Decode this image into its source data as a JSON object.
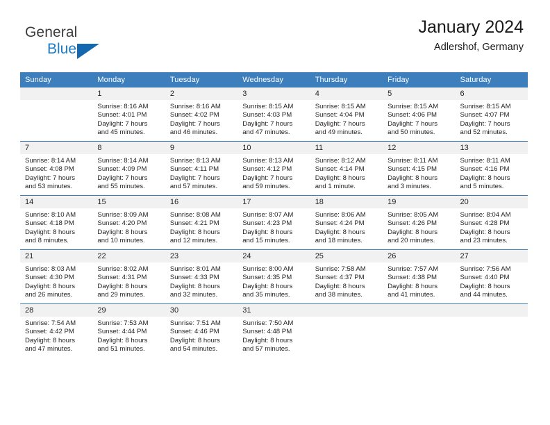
{
  "brand": {
    "line1": "General",
    "line2": "Blue",
    "triangle_color": "#1368b0",
    "blue_text_color": "#1d7ac4"
  },
  "header": {
    "title": "January 2024",
    "subtitle": "Adlershof, Germany"
  },
  "theme": {
    "header_blue": "#3d7ebc",
    "daynum_gray": "#f1f1f1",
    "text": "#231f20"
  },
  "calendar": {
    "weekday_headers": [
      "Sunday",
      "Monday",
      "Tuesday",
      "Wednesday",
      "Thursday",
      "Friday",
      "Saturday"
    ],
    "weeks": [
      [
        {
          "day": "",
          "lines": []
        },
        {
          "day": "1",
          "lines": [
            "Sunrise: 8:16 AM",
            "Sunset: 4:01 PM",
            "Daylight: 7 hours",
            "and 45 minutes."
          ]
        },
        {
          "day": "2",
          "lines": [
            "Sunrise: 8:16 AM",
            "Sunset: 4:02 PM",
            "Daylight: 7 hours",
            "and 46 minutes."
          ]
        },
        {
          "day": "3",
          "lines": [
            "Sunrise: 8:15 AM",
            "Sunset: 4:03 PM",
            "Daylight: 7 hours",
            "and 47 minutes."
          ]
        },
        {
          "day": "4",
          "lines": [
            "Sunrise: 8:15 AM",
            "Sunset: 4:04 PM",
            "Daylight: 7 hours",
            "and 49 minutes."
          ]
        },
        {
          "day": "5",
          "lines": [
            "Sunrise: 8:15 AM",
            "Sunset: 4:06 PM",
            "Daylight: 7 hours",
            "and 50 minutes."
          ]
        },
        {
          "day": "6",
          "lines": [
            "Sunrise: 8:15 AM",
            "Sunset: 4:07 PM",
            "Daylight: 7 hours",
            "and 52 minutes."
          ]
        }
      ],
      [
        {
          "day": "7",
          "lines": [
            "Sunrise: 8:14 AM",
            "Sunset: 4:08 PM",
            "Daylight: 7 hours",
            "and 53 minutes."
          ]
        },
        {
          "day": "8",
          "lines": [
            "Sunrise: 8:14 AM",
            "Sunset: 4:09 PM",
            "Daylight: 7 hours",
            "and 55 minutes."
          ]
        },
        {
          "day": "9",
          "lines": [
            "Sunrise: 8:13 AM",
            "Sunset: 4:11 PM",
            "Daylight: 7 hours",
            "and 57 minutes."
          ]
        },
        {
          "day": "10",
          "lines": [
            "Sunrise: 8:13 AM",
            "Sunset: 4:12 PM",
            "Daylight: 7 hours",
            "and 59 minutes."
          ]
        },
        {
          "day": "11",
          "lines": [
            "Sunrise: 8:12 AM",
            "Sunset: 4:14 PM",
            "Daylight: 8 hours",
            "and 1 minute."
          ]
        },
        {
          "day": "12",
          "lines": [
            "Sunrise: 8:11 AM",
            "Sunset: 4:15 PM",
            "Daylight: 8 hours",
            "and 3 minutes."
          ]
        },
        {
          "day": "13",
          "lines": [
            "Sunrise: 8:11 AM",
            "Sunset: 4:16 PM",
            "Daylight: 8 hours",
            "and 5 minutes."
          ]
        }
      ],
      [
        {
          "day": "14",
          "lines": [
            "Sunrise: 8:10 AM",
            "Sunset: 4:18 PM",
            "Daylight: 8 hours",
            "and 8 minutes."
          ]
        },
        {
          "day": "15",
          "lines": [
            "Sunrise: 8:09 AM",
            "Sunset: 4:20 PM",
            "Daylight: 8 hours",
            "and 10 minutes."
          ]
        },
        {
          "day": "16",
          "lines": [
            "Sunrise: 8:08 AM",
            "Sunset: 4:21 PM",
            "Daylight: 8 hours",
            "and 12 minutes."
          ]
        },
        {
          "day": "17",
          "lines": [
            "Sunrise: 8:07 AM",
            "Sunset: 4:23 PM",
            "Daylight: 8 hours",
            "and 15 minutes."
          ]
        },
        {
          "day": "18",
          "lines": [
            "Sunrise: 8:06 AM",
            "Sunset: 4:24 PM",
            "Daylight: 8 hours",
            "and 18 minutes."
          ]
        },
        {
          "day": "19",
          "lines": [
            "Sunrise: 8:05 AM",
            "Sunset: 4:26 PM",
            "Daylight: 8 hours",
            "and 20 minutes."
          ]
        },
        {
          "day": "20",
          "lines": [
            "Sunrise: 8:04 AM",
            "Sunset: 4:28 PM",
            "Daylight: 8 hours",
            "and 23 minutes."
          ]
        }
      ],
      [
        {
          "day": "21",
          "lines": [
            "Sunrise: 8:03 AM",
            "Sunset: 4:30 PM",
            "Daylight: 8 hours",
            "and 26 minutes."
          ]
        },
        {
          "day": "22",
          "lines": [
            "Sunrise: 8:02 AM",
            "Sunset: 4:31 PM",
            "Daylight: 8 hours",
            "and 29 minutes."
          ]
        },
        {
          "day": "23",
          "lines": [
            "Sunrise: 8:01 AM",
            "Sunset: 4:33 PM",
            "Daylight: 8 hours",
            "and 32 minutes."
          ]
        },
        {
          "day": "24",
          "lines": [
            "Sunrise: 8:00 AM",
            "Sunset: 4:35 PM",
            "Daylight: 8 hours",
            "and 35 minutes."
          ]
        },
        {
          "day": "25",
          "lines": [
            "Sunrise: 7:58 AM",
            "Sunset: 4:37 PM",
            "Daylight: 8 hours",
            "and 38 minutes."
          ]
        },
        {
          "day": "26",
          "lines": [
            "Sunrise: 7:57 AM",
            "Sunset: 4:38 PM",
            "Daylight: 8 hours",
            "and 41 minutes."
          ]
        },
        {
          "day": "27",
          "lines": [
            "Sunrise: 7:56 AM",
            "Sunset: 4:40 PM",
            "Daylight: 8 hours",
            "and 44 minutes."
          ]
        }
      ],
      [
        {
          "day": "28",
          "lines": [
            "Sunrise: 7:54 AM",
            "Sunset: 4:42 PM",
            "Daylight: 8 hours",
            "and 47 minutes."
          ]
        },
        {
          "day": "29",
          "lines": [
            "Sunrise: 7:53 AM",
            "Sunset: 4:44 PM",
            "Daylight: 8 hours",
            "and 51 minutes."
          ]
        },
        {
          "day": "30",
          "lines": [
            "Sunrise: 7:51 AM",
            "Sunset: 4:46 PM",
            "Daylight: 8 hours",
            "and 54 minutes."
          ]
        },
        {
          "day": "31",
          "lines": [
            "Sunrise: 7:50 AM",
            "Sunset: 4:48 PM",
            "Daylight: 8 hours",
            "and 57 minutes."
          ]
        },
        {
          "day": "",
          "lines": []
        },
        {
          "day": "",
          "lines": []
        },
        {
          "day": "",
          "lines": []
        }
      ]
    ]
  }
}
